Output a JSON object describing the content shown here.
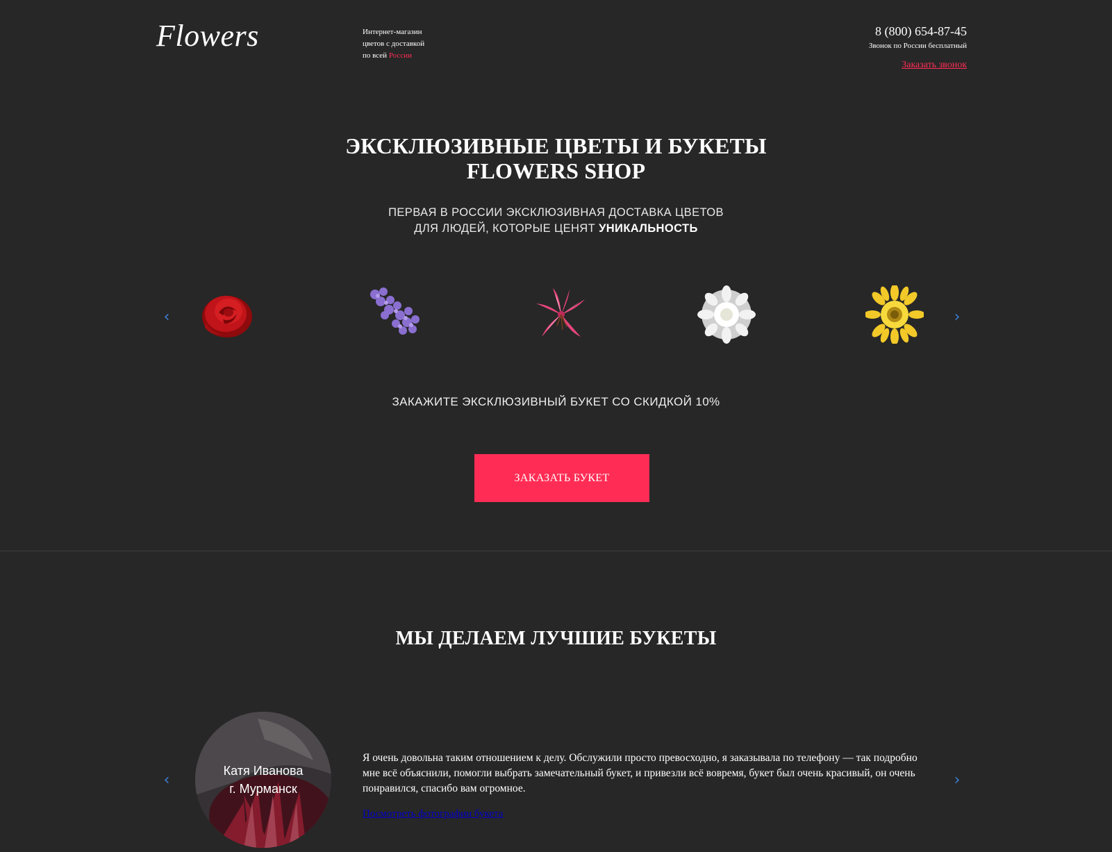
{
  "header": {
    "logo": "Flowers",
    "tagline_line1": "Интернет-магазин",
    "tagline_line2": "цветов с доставкой",
    "tagline_line3_prefix": "по всей",
    "tagline_line3_accent": "России",
    "phone": "8 (800) 654-87-45",
    "phone_note": "Звонок по России бесплатный",
    "callback_label": "Заказать звонок"
  },
  "hero": {
    "title_line1": "ЭКСКЛЮЗИВНЫЕ ЦВЕТЫ И БУКЕТЫ",
    "title_line2": "FLOWERS SHOP",
    "subtitle_line1": "ПЕРВАЯ В РОССИИ ЭКСКЛЮЗИВНАЯ ДОСТАВКА ЦВЕТОВ",
    "subtitle_line2_prefix": "ДЛЯ ЛЮДЕЙ, КОТОРЫЕ ЦЕНЯТ",
    "subtitle_line2_bold": "УНИКАЛЬНОСТЬ"
  },
  "carousel": {
    "prev_icon": "chevron-left-icon",
    "next_icon": "chevron-right-icon",
    "items": [
      "red-rose",
      "lilac",
      "pink-lily",
      "white-dahlia",
      "yellow-gerbera"
    ]
  },
  "promo": {
    "text": "ЗАКАЖИТЕ ЭКСКЛЮЗИВНЫЙ БУКЕТ СО СКИДКОЙ 10%",
    "button_label": "ЗАКАЗАТЬ БУКЕТ"
  },
  "reviews": {
    "title": "МЫ ДЕЛАЕМ ЛУЧШИЕ БУКЕТЫ",
    "name": "Катя Иванова",
    "city": "г. Мурманск",
    "text": "Я очень довольна таким отношением к делу. Обслужили просто превосходно, я заказывала по телефону — так подробно мне всё объяснили, помогли выбрать замечательный букет, и привезли всё вовремя, букет был очень красивый, он очень понравился, спасибо вам огромное.",
    "link_label": "Посмотреть фотографии букета"
  },
  "colors": {
    "background": "#272727",
    "accent": "#ff2d55",
    "arrow": "#3d7fd6",
    "link": "#0000c8"
  }
}
